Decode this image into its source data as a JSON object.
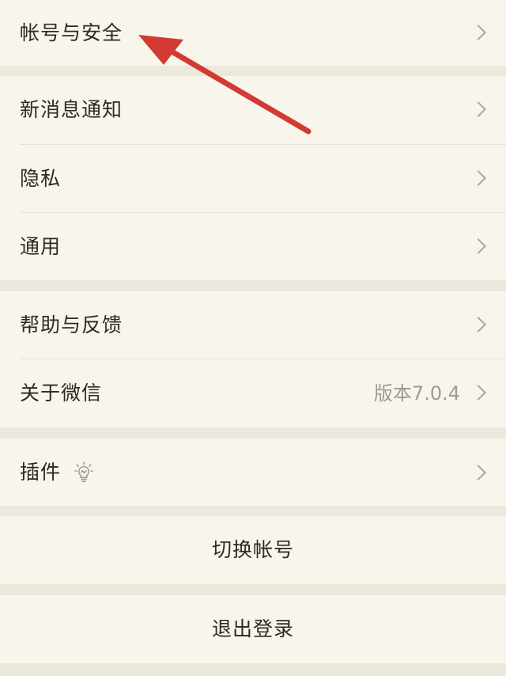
{
  "settings": {
    "account_security": "帐号与安全",
    "notifications": "新消息通知",
    "privacy": "隐私",
    "general": "通用",
    "help_feedback": "帮助与反馈",
    "about": "关于微信",
    "version": "版本7.0.4",
    "plugins": "插件",
    "switch_account": "切换帐号",
    "logout": "退出登录"
  },
  "icons": {
    "chevron": "chevron-right-icon",
    "plugin_badge": "lightbulb-icon"
  },
  "colors": {
    "background": "#ece8dc",
    "panel": "#f8f6ec",
    "annotation_arrow": "#d33a33"
  }
}
